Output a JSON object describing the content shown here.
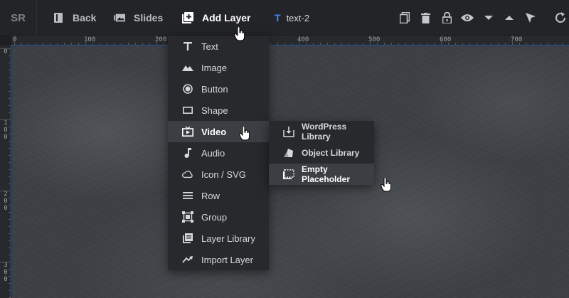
{
  "toolbar": {
    "logo": "SR",
    "back_label": "Back",
    "slides_label": "Slides",
    "add_layer_label": "Add Layer",
    "layer_name": "text-2",
    "layer_type_glyph": "T"
  },
  "ruler": {
    "top_labels": [
      "0",
      "100",
      "200",
      "300",
      "400",
      "500",
      "600",
      "700"
    ],
    "left_labels": [
      [
        "0"
      ],
      [
        "1",
        "0",
        "0"
      ],
      [
        "2",
        "0",
        "0"
      ],
      [
        "3",
        "0",
        "0"
      ]
    ]
  },
  "menu": {
    "items": [
      {
        "label": "Text",
        "icon": "text-icon"
      },
      {
        "label": "Image",
        "icon": "image-icon"
      },
      {
        "label": "Button",
        "icon": "button-icon"
      },
      {
        "label": "Shape",
        "icon": "shape-icon"
      },
      {
        "label": "Video",
        "icon": "video-icon"
      },
      {
        "label": "Audio",
        "icon": "audio-icon"
      },
      {
        "label": "Icon / SVG",
        "icon": "cloud-icon"
      },
      {
        "label": "Row",
        "icon": "row-icon"
      },
      {
        "label": "Group",
        "icon": "group-icon"
      },
      {
        "label": "Layer Library",
        "icon": "layer-library-icon"
      },
      {
        "label": "Import Layer",
        "icon": "import-icon"
      }
    ]
  },
  "submenu": {
    "items": [
      {
        "label": "WordPress Library",
        "icon": "download-icon"
      },
      {
        "label": "Object Library",
        "icon": "object-icon"
      },
      {
        "label": "Empty Placeholder",
        "icon": "placeholder-icon"
      }
    ]
  },
  "colors": {
    "accent": "#3b8ef3",
    "ruler_line": "#3a77c2",
    "menu_bg": "#27292c",
    "menu_hover": "#3b3e42"
  }
}
